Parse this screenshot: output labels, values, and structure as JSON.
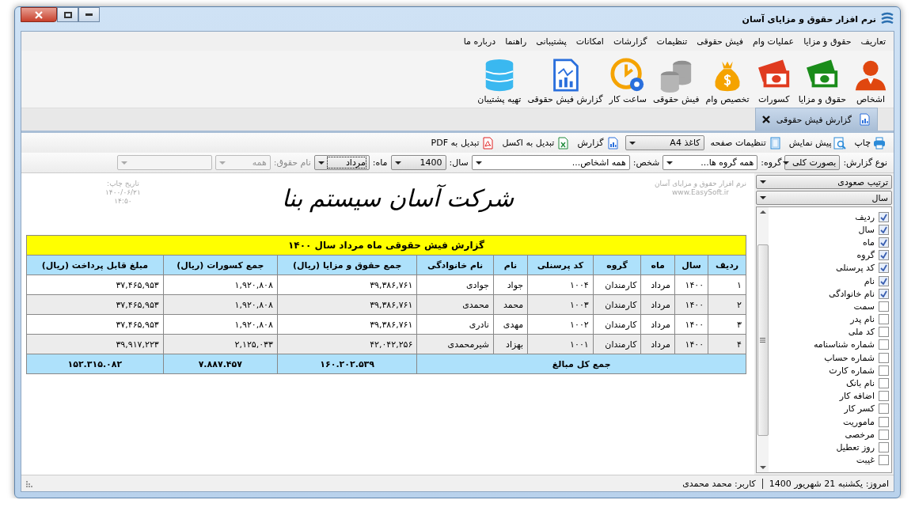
{
  "window": {
    "title": "نرم افزار حقوق و مزایای آسان"
  },
  "menu": [
    "تعاریف",
    "حقوق و مزایا",
    "عملیات وام",
    "فیش حقوقی",
    "تنظیمات",
    "گزارشات",
    "امکانات",
    "پشتیبانی",
    "راهنما",
    "درباره ما"
  ],
  "ribbon": [
    {
      "label": "اشخاص",
      "kind": "person"
    },
    {
      "label": "حقوق و مزایا",
      "kind": "money_green"
    },
    {
      "label": "کسورات",
      "kind": "money_red"
    },
    {
      "label": "تخصیص وام",
      "kind": "bag"
    },
    {
      "label": "فیش حقوقی",
      "kind": "coins"
    },
    {
      "label": "ساعت کار",
      "kind": "clock"
    },
    {
      "label": "گزارش فیش حقوقی",
      "kind": "report"
    },
    {
      "label": "تهیه پشتیبان",
      "kind": "database"
    }
  ],
  "tabs": [
    {
      "label": "گزارش فیش حقوقی",
      "selected": true
    }
  ],
  "toolbar": [
    {
      "label": "چاپ",
      "kind": "print"
    },
    {
      "label": "پیش نمایش",
      "kind": "preview"
    },
    {
      "label": "تنظیمات صفحه",
      "kind": "page"
    },
    {
      "label": "کاغذ A4",
      "kind": "combo"
    },
    {
      "label": "گزارش",
      "kind": "report"
    },
    {
      "label": "تبدیل به اکسل",
      "kind": "excel"
    },
    {
      "label": "تبدیل به PDF",
      "kind": "pdf"
    }
  ],
  "filters": [
    {
      "label": "نوع گزارش:",
      "value": "بصورت کلی",
      "kind": "combo",
      "disabled": false,
      "focused": false
    },
    {
      "label": "گروه:",
      "value": "همه گروه ها...",
      "kind": "wide",
      "disabled": false,
      "focused": false
    },
    {
      "label": "شخص:",
      "value": "همه اشخاص...",
      "kind": "wider",
      "disabled": false,
      "focused": false
    },
    {
      "label": "سال:",
      "value": "1400",
      "kind": "combo",
      "disabled": false,
      "focused": false
    },
    {
      "label": "ماه:",
      "value": "مرداد",
      "kind": "combo",
      "disabled": false,
      "focused": true
    },
    {
      "label": "نام حقوق:",
      "value": "همه",
      "kind": "combo",
      "disabled": true,
      "focused": false
    },
    {
      "kind": "wide",
      "disabled": true,
      "focused": false
    }
  ],
  "report": {
    "software_note": [
      "نرم افزار حقوق و مزایای آسان",
      "www.EasySoft.ir"
    ],
    "company": "شرکت آسان سیستم بنا",
    "print_date": [
      "تاریخ چاپ:",
      "۱۴۰۰/۰۶/۲۱",
      "۱۴:۵۰"
    ],
    "table": {
      "title": "گزارش فیش حقوقی ماه مرداد سال ۱۴۰۰",
      "columns": [
        "ردیف",
        "سال",
        "ماه",
        "گروه",
        "کد پرسنلی",
        "نام",
        "نام خانوادگی",
        "جمع حقوق و مزایا (ریال)",
        "جمع کسورات (ریال)",
        "مبلغ قابل پرداخت (ریال)"
      ],
      "rows": [
        [
          "۱",
          "۱۴۰۰",
          "مرداد",
          "کارمندان",
          "۱۰۰۴",
          "جواد",
          "جوادی",
          "۳۹,۳۸۶,۷۶۱",
          "۱,۹۲۰,۸۰۸",
          "۳۷,۴۶۵,۹۵۳"
        ],
        [
          "۲",
          "۱۴۰۰",
          "مرداد",
          "کارمندان",
          "۱۰۰۳",
          "محمد",
          "محمدی",
          "۳۹,۳۸۶,۷۶۱",
          "۱,۹۲۰,۸۰۸",
          "۳۷,۴۶۵,۹۵۳"
        ],
        [
          "۳",
          "۱۴۰۰",
          "مرداد",
          "کارمندان",
          "۱۰۰۲",
          "مهدی",
          "نادری",
          "۳۹,۳۸۶,۷۶۱",
          "۱,۹۲۰,۸۰۸",
          "۳۷,۴۶۵,۹۵۳"
        ],
        [
          "۴",
          "۱۴۰۰",
          "مرداد",
          "کارمندان",
          "۱۰۰۱",
          "بهزاد",
          "شیرمحمدی",
          "۴۲,۰۴۲,۲۵۶",
          "۲,۱۲۵,۰۳۳",
          "۳۹,۹۱۷,۲۲۳"
        ]
      ],
      "total_label": "جمع کل مبالغ",
      "totals": [
        "۱۶۰.۲۰۲.۵۳۹",
        "۷.۸۸۷.۴۵۷",
        "۱۵۲.۳۱۵.۰۸۲"
      ]
    }
  },
  "side_panel": {
    "sort": "ترتیب صعودی",
    "group_by": "سال",
    "fields": [
      {
        "label": "ردیف",
        "checked": true
      },
      {
        "label": "سال",
        "checked": true
      },
      {
        "label": "ماه",
        "checked": true
      },
      {
        "label": "گروه",
        "checked": true
      },
      {
        "label": "کد پرسنلی",
        "checked": true
      },
      {
        "label": "نام",
        "checked": true
      },
      {
        "label": "نام خانوادگی",
        "checked": true
      },
      {
        "label": "سمت",
        "checked": false
      },
      {
        "label": "نام پدر",
        "checked": false
      },
      {
        "label": "کد ملی",
        "checked": false
      },
      {
        "label": "شماره شناسنامه",
        "checked": false
      },
      {
        "label": "شماره حساب",
        "checked": false
      },
      {
        "label": "شماره کارت",
        "checked": false
      },
      {
        "label": "نام بانک",
        "checked": false
      },
      {
        "label": "اضافه کار",
        "checked": false
      },
      {
        "label": "کسر کار",
        "checked": false
      },
      {
        "label": "ماموریت",
        "checked": false
      },
      {
        "label": "مرخصی",
        "checked": false
      },
      {
        "label": "روز تعطیل",
        "checked": false
      },
      {
        "label": "غیبت",
        "checked": false
      }
    ]
  },
  "status_bar": {
    "today": "امروز: یکشنبه 21 شهریور 1400",
    "user": "کاربر: محمد محمدی"
  }
}
